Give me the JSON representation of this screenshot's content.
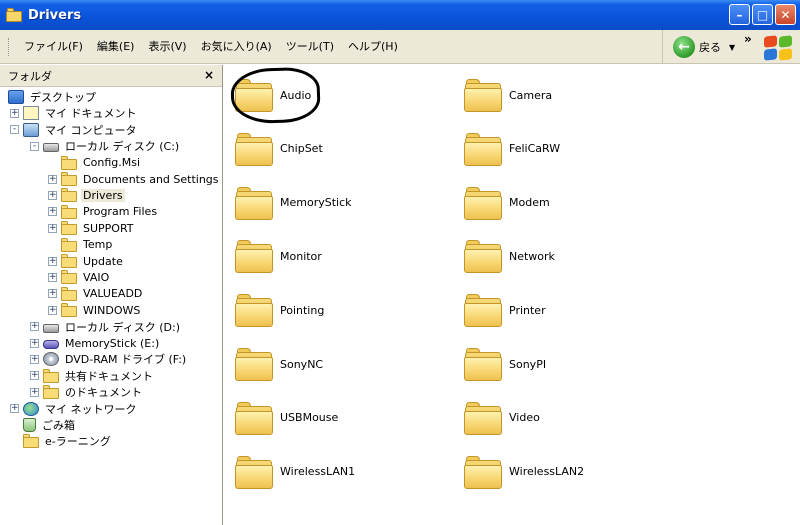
{
  "window": {
    "title": "Drivers"
  },
  "menu": {
    "items": [
      "ファイル(F)",
      "編集(E)",
      "表示(V)",
      "お気に入り(A)",
      "ツール(T)",
      "ヘルプ(H)"
    ],
    "back_label": "戻る",
    "chevron": "»"
  },
  "folder_pane": {
    "title": "フォルダ",
    "close": "×",
    "tree": [
      {
        "label": "デスクトップ",
        "icon": "desktop-icon",
        "toggle": "",
        "depth": 0
      },
      {
        "label": "マイ ドキュメント",
        "icon": "my-documents-icon",
        "toggle": "+",
        "depth": 1
      },
      {
        "label": "マイ コンピュータ",
        "icon": "my-computer-icon",
        "toggle": "-",
        "depth": 1
      },
      {
        "label": "ローカル ディスク (C:)",
        "icon": "hard-drive-icon",
        "toggle": "-",
        "depth": 2
      },
      {
        "label": "Config.Msi",
        "icon": "folder-icon",
        "toggle": "",
        "depth": 3
      },
      {
        "label": "Documents and Settings",
        "icon": "folder-icon",
        "toggle": "+",
        "depth": 3
      },
      {
        "label": "Drivers",
        "icon": "folder-icon",
        "toggle": "+",
        "depth": 3,
        "selected": true
      },
      {
        "label": "Program Files",
        "icon": "folder-icon",
        "toggle": "+",
        "depth": 3
      },
      {
        "label": "SUPPORT",
        "icon": "folder-icon",
        "toggle": "+",
        "depth": 3
      },
      {
        "label": "Temp",
        "icon": "folder-icon",
        "toggle": "",
        "depth": 3
      },
      {
        "label": "Update",
        "icon": "folder-icon",
        "toggle": "+",
        "depth": 3
      },
      {
        "label": "VAIO",
        "icon": "folder-icon",
        "toggle": "+",
        "depth": 3
      },
      {
        "label": "VALUEADD",
        "icon": "folder-icon",
        "toggle": "+",
        "depth": 3
      },
      {
        "label": "WINDOWS",
        "icon": "folder-icon",
        "toggle": "+",
        "depth": 3
      },
      {
        "label": "ローカル ディスク (D:)",
        "icon": "hard-drive-icon",
        "toggle": "+",
        "depth": 2
      },
      {
        "label": "MemoryStick (E:)",
        "icon": "memory-stick-icon",
        "toggle": "+",
        "depth": 2
      },
      {
        "label": "DVD-RAM ドライブ (F:)",
        "icon": "dvd-drive-icon",
        "toggle": "+",
        "depth": 2
      },
      {
        "label": "共有ドキュメント",
        "icon": "folder-icon",
        "toggle": "+",
        "depth": 2
      },
      {
        "label": "のドキュメント",
        "icon": "folder-icon",
        "toggle": "+",
        "depth": 2
      },
      {
        "label": "マイ ネットワーク",
        "icon": "network-icon",
        "toggle": "+",
        "depth": 1
      },
      {
        "label": "ごみ箱",
        "icon": "recycle-bin-icon",
        "toggle": "",
        "depth": 1
      },
      {
        "label": "e-ラーニング",
        "icon": "folder-icon",
        "toggle": "",
        "depth": 1
      }
    ]
  },
  "content": {
    "folders": [
      "Audio",
      "Camera",
      "ChipSet",
      "FeliCaRW",
      "MemoryStick",
      "Modem",
      "Monitor",
      "Network",
      "Pointing",
      "Printer",
      "SonyNC",
      "SonyPI",
      "USBMouse",
      "Video",
      "WirelessLAN1",
      "WirelessLAN2"
    ]
  }
}
